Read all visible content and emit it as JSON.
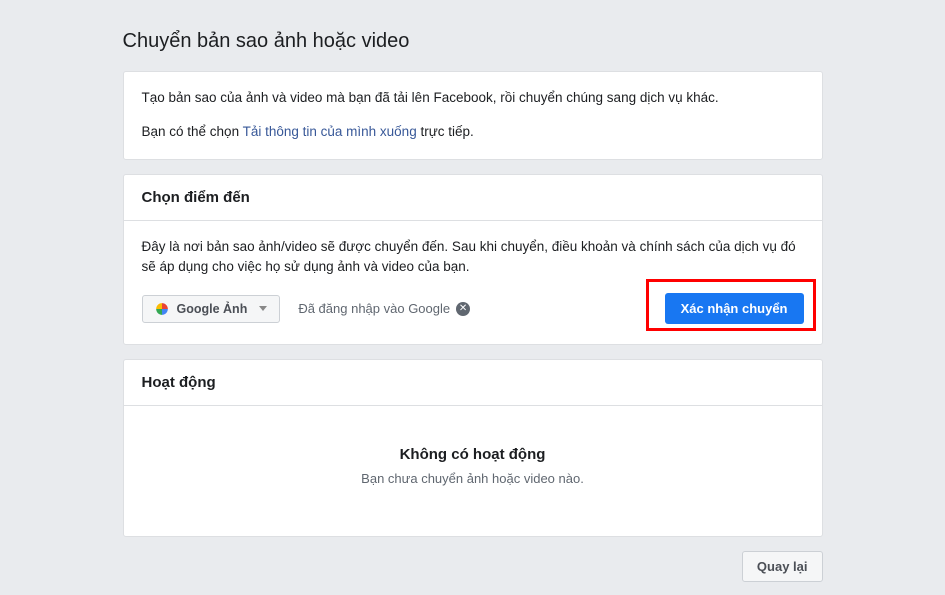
{
  "page_title": "Chuyển bản sao ảnh hoặc video",
  "intro": {
    "line1": "Tạo bản sao của ảnh và video mà bạn đã tải lên Facebook, rồi chuyển chúng sang dịch vụ khác.",
    "line2_prefix": "Bạn có thể chọn ",
    "line2_link": "Tải thông tin của mình xuống",
    "line2_suffix": " trực tiếp."
  },
  "destination": {
    "header": "Chọn điểm đến",
    "description": "Đây là nơi bản sao ảnh/video sẽ được chuyển đến. Sau khi chuyển, điều khoản và chính sách của dịch vụ đó sẽ áp dụng cho việc họ sử dụng ảnh và video của bạn.",
    "selected_service": "Google Ảnh",
    "login_status": "Đã đăng nhập vào Google",
    "confirm_button": "Xác nhận chuyển"
  },
  "activity": {
    "header": "Hoạt động",
    "empty_title": "Không có hoạt động",
    "empty_subtitle": "Bạn chưa chuyển ảnh hoặc video nào."
  },
  "footer": {
    "back_button": "Quay lại"
  }
}
